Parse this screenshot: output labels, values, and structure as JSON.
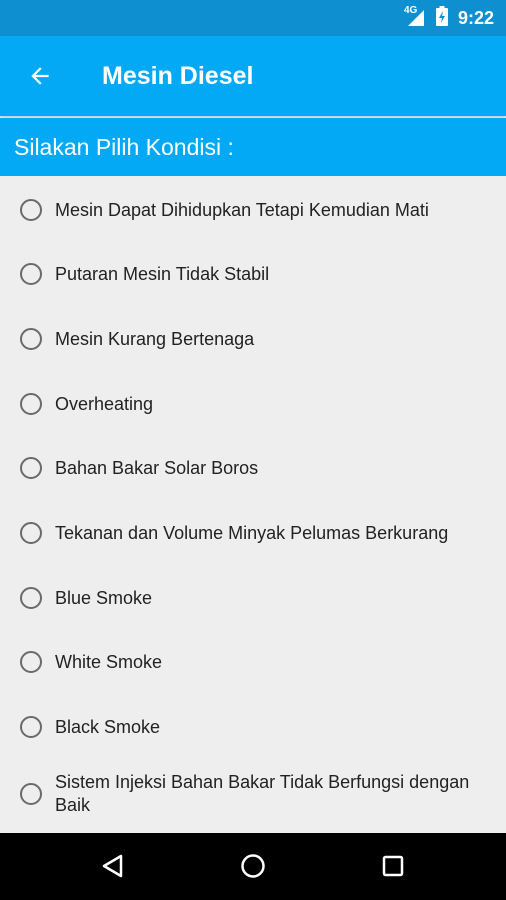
{
  "status_bar": {
    "network": "4G",
    "time": "9:22"
  },
  "app_bar": {
    "title": "Mesin Diesel",
    "back_icon": "arrow-back-icon"
  },
  "prompt": "Silakan Pilih Kondisi :",
  "options": [
    {
      "label": "Mesin Dapat Dihidupkan Tetapi Kemudian Mati",
      "checked": false
    },
    {
      "label": "Putaran Mesin Tidak Stabil",
      "checked": false
    },
    {
      "label": "Mesin Kurang Bertenaga",
      "checked": false
    },
    {
      "label": "Overheating",
      "checked": false
    },
    {
      "label": "Bahan Bakar Solar Boros",
      "checked": false
    },
    {
      "label": "Tekanan dan Volume Minyak Pelumas Berkurang",
      "checked": false
    },
    {
      "label": "Blue Smoke",
      "checked": false
    },
    {
      "label": "White Smoke",
      "checked": false
    },
    {
      "label": "Black Smoke",
      "checked": false
    },
    {
      "label": "Sistem Injeksi Bahan Bakar Tidak Berfungsi dengan Baik",
      "checked": false
    }
  ],
  "colors": {
    "status_bar": "#0d8fd0",
    "app_bar": "#03a9f4",
    "background": "#eeeeee",
    "nav_bar": "#000000"
  }
}
